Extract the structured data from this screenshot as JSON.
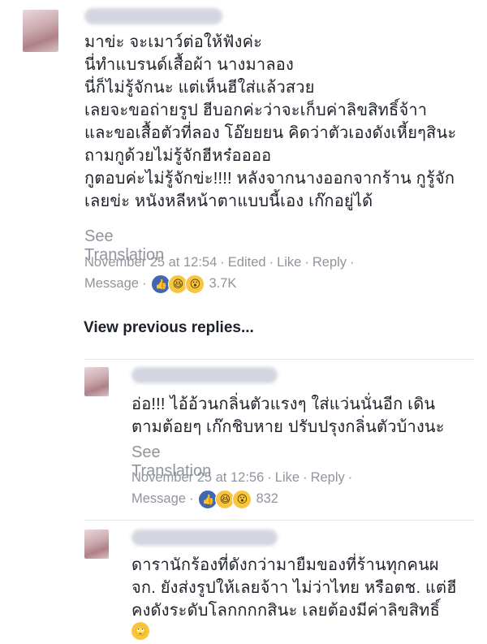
{
  "comments": [
    {
      "body": "มาข่ะ จะเมาว์ต่อให้ฟังค่ะ\nนี่ทำแบรนด์เสื้อผ้า นางมาลอง\nนี่ก็ไม่รู้จักนะ แต่เห็นฮีใส่แล้วสวย\nเลยจะขอถ่ายรูป ฮีบอกค่ะว่าจะเก็บค่าลิขสิทธิ์จ้าา\nและขอเสื้อตัวที่ลอง โอ๊ยยยน คิดว่าตัวเองดังเหี้ยๆสินะ\nถามกูด้วยไม่รู้จักฮีหร๋ออออ\nกูตอบค่ะไม่รู้จักข่ะ!!!! หลังจากนางออกจากร้าน กูรู้จัก\nเลยข่ะ หนังหลีหน้าตาแบบนี้เอง เก๊กอยู่ได้",
      "see_translation": "See Translation",
      "date": "November 25 at 12:54",
      "edited": "Edited",
      "like": "Like",
      "reply": "Reply",
      "message": "Message",
      "reaction_count": "3.7K"
    },
    {
      "body": "อ่อ!!! ไอ้อ้วนกลิ่นตัวแรงๆ ใส่แว่นนั่นอีก เดิน\nตามต้อยๆ เก๊กชิบหาย ปรับปรุงกลิ่นตัวบ้างนะ",
      "see_translation": "See Translation",
      "date": "November 25 at 12:56",
      "like": "Like",
      "reply": "Reply",
      "message": "Message",
      "reaction_count": "832"
    },
    {
      "body": "ดารานักร้องที่ดังกว่ามายืมของที่ร้านทุกคนผ\nจก. ยังส่งรูปให้เลยจ้าา ไม่ว่าไทย หรือตช. แต่ฮี\nคงดังระดับโลกกกกสินะ เลยต้องมีค่าลิขสิทธิ์"
    }
  ],
  "view_previous_replies": "View previous replies...",
  "reaction_icons": [
    "like-icon",
    "haha-icon",
    "wow-icon"
  ],
  "colors": {
    "link_gray": "#90949c",
    "like_blue": "#4267b2",
    "emoji_yellow": "#f7c63e"
  }
}
